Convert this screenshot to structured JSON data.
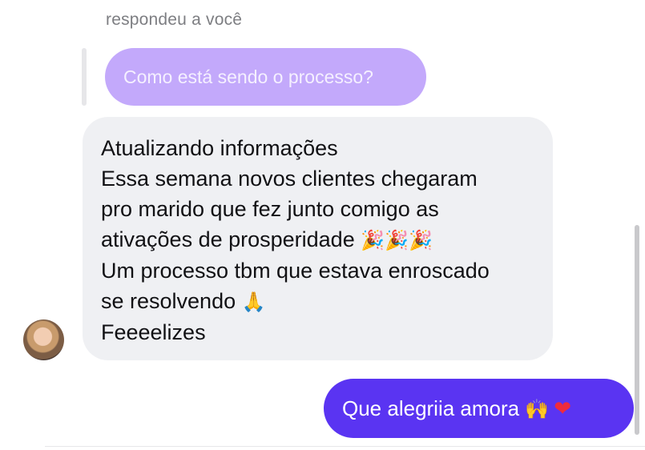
{
  "conversation": {
    "reply_label": "respondeu a você",
    "quoted_message": "Como está sendo o processo?",
    "incoming_message": {
      "lines": [
        "Atualizando informações",
        "Essa semana novos clientes chegaram",
        "pro marido que fez junto comigo as",
        "ativações de prosperidade",
        "Um processo tbm que estava enroscado",
        "se resolvendo",
        "Feeeelizes"
      ],
      "emoji_after_line_4": "🎉🎉🎉",
      "emoji_after_line_6": "🙏"
    },
    "outgoing_message": {
      "text": "Que alegriia amora",
      "emoji": "🙌",
      "heart": "❤"
    }
  },
  "colors": {
    "quoted_bubble": "#c3a9fb",
    "incoming_bubble": "#eff0f3",
    "outgoing_bubble": "#5a34f2",
    "heart": "#ef2b3c"
  }
}
